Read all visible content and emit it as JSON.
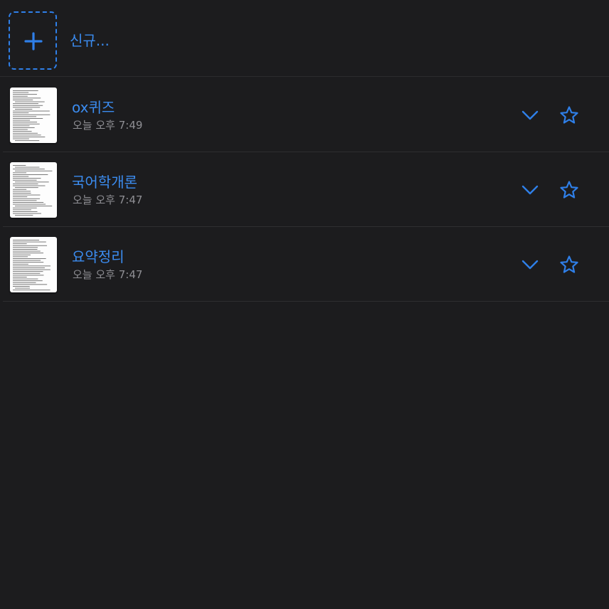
{
  "accent_color": "#2f7fe8",
  "background_color": "#1c1c1e",
  "new_document": {
    "label": "신규...",
    "icon": "plus-icon"
  },
  "documents": [
    {
      "title": "ox퀴즈",
      "modified": "오늘 오후 7:49",
      "expand_icon": "chevron-down-icon",
      "favorite_icon": "star-icon"
    },
    {
      "title": "국어학개론",
      "modified": "오늘 오후 7:47",
      "expand_icon": "chevron-down-icon",
      "favorite_icon": "star-icon"
    },
    {
      "title": "요약정리",
      "modified": "오늘 오후 7:47",
      "expand_icon": "chevron-down-icon",
      "favorite_icon": "star-icon"
    }
  ]
}
